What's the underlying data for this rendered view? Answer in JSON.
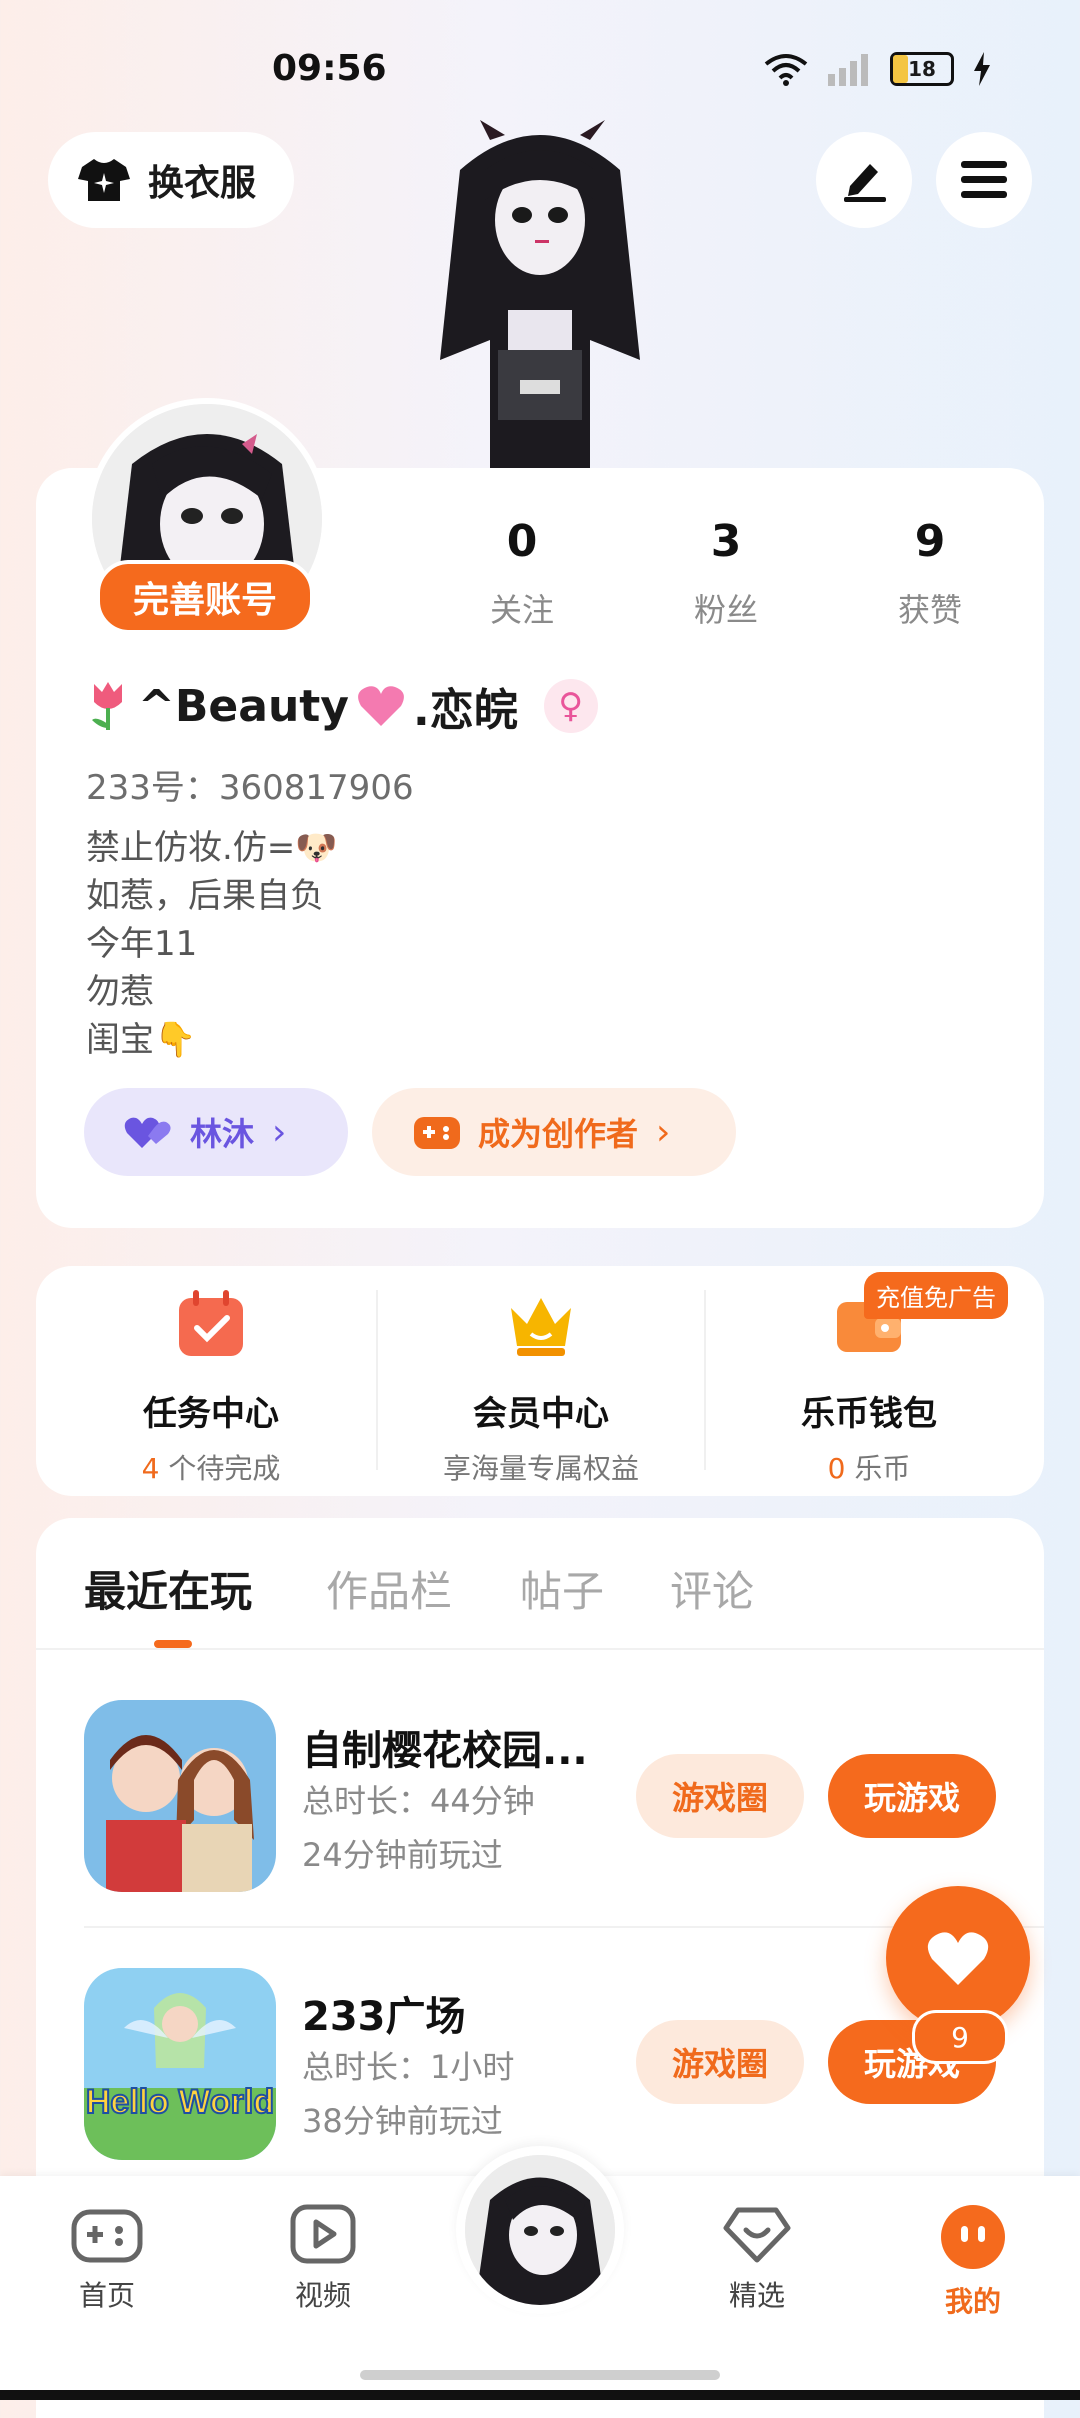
{
  "status": {
    "time": "09:56",
    "battery": "18"
  },
  "header": {
    "wardrobe_label": "换衣服",
    "edit_icon": "pen-icon",
    "menu_icon": "hamburger-icon"
  },
  "profile": {
    "complete_label": "完善账号",
    "stats": [
      {
        "value": "0",
        "label": "关注"
      },
      {
        "value": "3",
        "label": "粉丝"
      },
      {
        "value": "9",
        "label": "获赞"
      }
    ],
    "name": "^Beauty",
    "name_suffix": ".恋皖",
    "uid_label": "233号：360817906",
    "bio": [
      "禁止仿妆.仿=🐶",
      "如惹，后果自负",
      "今年11",
      "勿惹",
      "闺宝👇"
    ],
    "lin_label": "林沐",
    "creator_label": "成为创作者"
  },
  "features": {
    "promo_tag": "充值免广告",
    "items": [
      {
        "title": "任务中心",
        "sub_num": "4",
        "sub_text": " 个待完成"
      },
      {
        "title": "会员中心",
        "sub_text": "享海量专属权益"
      },
      {
        "title": "乐币钱包",
        "sub_num": "0",
        "sub_text": " 乐币"
      }
    ]
  },
  "tabs": [
    "最近在玩",
    "作品栏",
    "帖子",
    "评论"
  ],
  "games": [
    {
      "title": "自制樱花校园...",
      "duration": "总时长：44分钟",
      "last": "24分钟前玩过",
      "circle": "游戏圈",
      "play": "玩游戏"
    },
    {
      "title": "233广场",
      "duration": "总时长：1小时",
      "last": "38分钟前玩过",
      "circle": "游戏圈",
      "play": "玩游戏",
      "icon_text": "Hello World"
    }
  ],
  "float_like_count": "9",
  "nav": [
    {
      "label": "首页"
    },
    {
      "label": "视频"
    },
    {
      "label": "精选"
    },
    {
      "label": "我的"
    }
  ],
  "colors": {
    "accent": "#f56a1d",
    "purple": "#6a55e0"
  }
}
